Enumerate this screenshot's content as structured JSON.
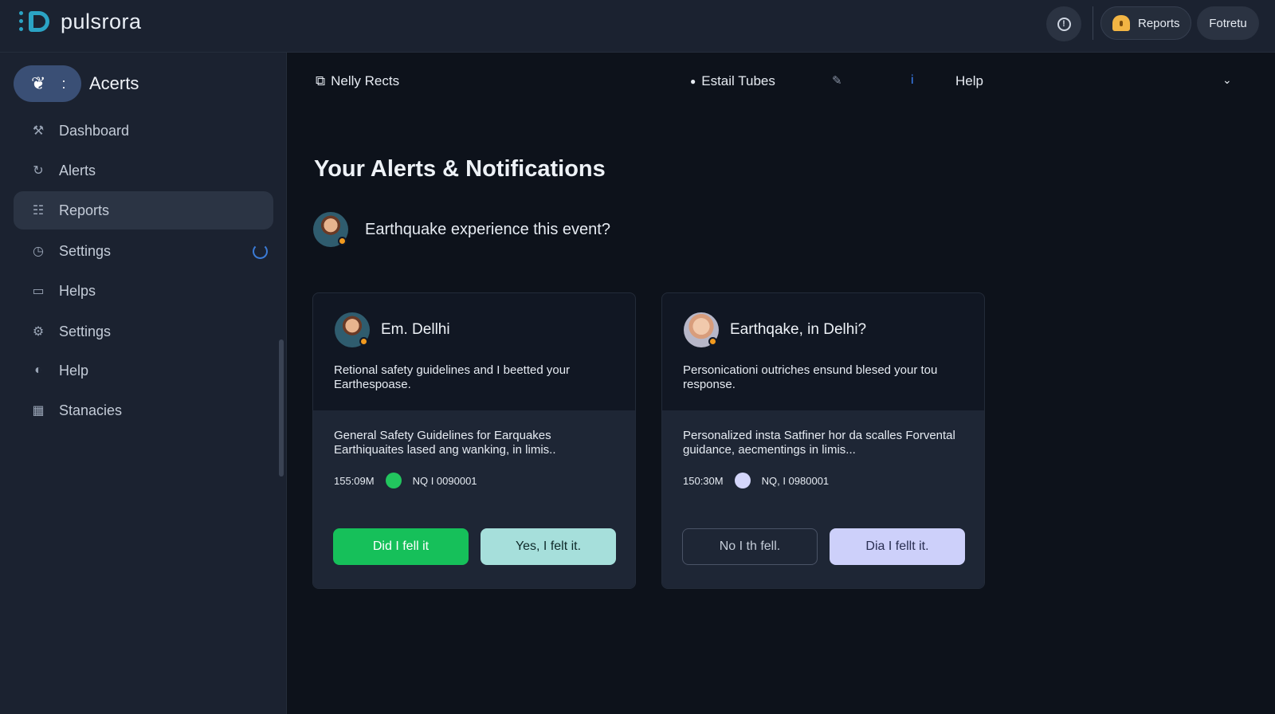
{
  "app": {
    "name": "pulsrora"
  },
  "topbar": {
    "info_icon": "info-icon",
    "reports_label": "Reports",
    "user_label": "Fotretu",
    "accent": "#f2b544"
  },
  "sidebar": {
    "header_title": "Acerts",
    "header_glyph": ":",
    "items": [
      {
        "label": "Dashboard",
        "icon": "tools-icon"
      },
      {
        "label": "Alerts",
        "icon": "refresh-icon"
      },
      {
        "label": "Reports",
        "icon": "list-icon",
        "active": true
      },
      {
        "label": "Settings",
        "icon": "clock-icon",
        "loading": true
      },
      {
        "label": "Helps",
        "icon": "monitor-icon"
      },
      {
        "label": "Settings",
        "icon": "user-settings-icon"
      },
      {
        "label": "Help",
        "icon": "globe-icon"
      },
      {
        "label": "Stanacies",
        "icon": "building-icon"
      }
    ]
  },
  "main": {
    "nav": {
      "item1": "Nelly Rects",
      "item2": "Estail Tubes",
      "item3": "i",
      "item4": "Help"
    },
    "title": "Your Alerts & Notifications",
    "prompt": "Earthquake experience this event?",
    "cards": [
      {
        "name": "Em. Dellhi",
        "description": "Retional safety guidelines and I beetted your Earthespoase.",
        "body": "General Safety Guidelines for Earquakes Earthiquaites lased ang wanking, in limis..",
        "time": "155:09M",
        "code": "NQ I 0090001",
        "status_color": "#22c55e",
        "button1": "Did I fell it",
        "button2": "Yes, I felt it."
      },
      {
        "name": "Earthqake, in Delhi?",
        "description": "Personicationi outriches ensund blesed your tou response.",
        "body": "Personalized insta Satfiner hor da scalles Forvental guidance, aecmentings in limis...",
        "time": "150:30M",
        "code": "NQ, I 0980001",
        "status_color": "#d4d6fb",
        "button1": "No I th fell.",
        "button2": "Dia I fellt it."
      }
    ]
  }
}
